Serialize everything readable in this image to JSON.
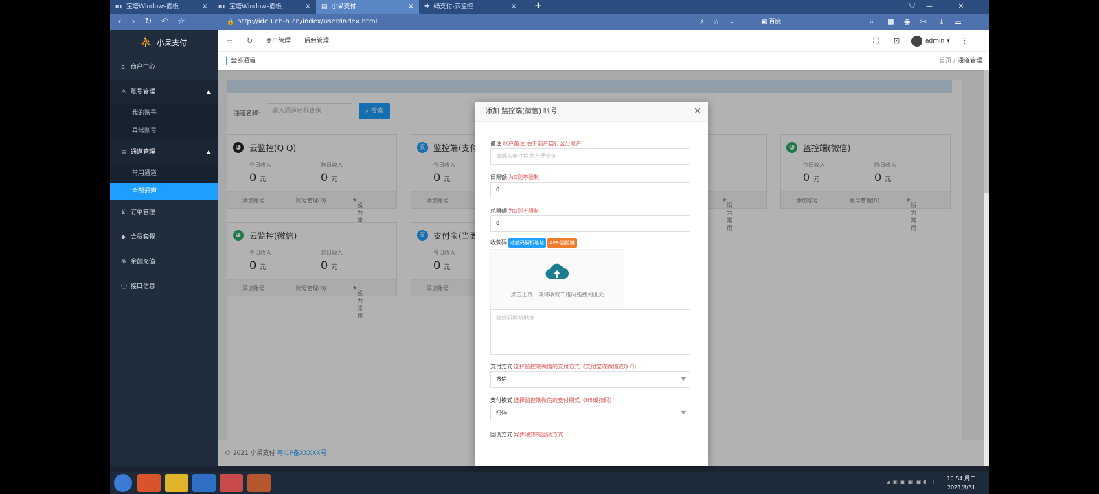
{
  "browser": {
    "tabs": [
      {
        "prefix": "BT",
        "label": "宝塔Windows面板",
        "active": false
      },
      {
        "prefix": "BT",
        "label": "宝塔Windows面板",
        "active": false
      },
      {
        "prefix": "",
        "label": "小呆支付",
        "active": true
      },
      {
        "prefix": "",
        "label": "码支付-云监控",
        "active": false
      }
    ],
    "url": "http://idc3.ch-h.cn/index/user/index.html",
    "search_engine": "百度"
  },
  "sidebar": {
    "brand": "小呆支付",
    "items": [
      {
        "label": "商户中心",
        "icon": "home-icon"
      },
      {
        "label": "账号管理",
        "icon": "user-icon",
        "open": true,
        "children": [
          "我的账号",
          "异常账号"
        ]
      },
      {
        "label": "通道管理",
        "icon": "channel-icon",
        "open": true,
        "children": [
          "常用通道",
          "全部通道"
        ]
      },
      {
        "label": "订单管理",
        "icon": "cart-icon"
      },
      {
        "label": "会员套餐",
        "icon": "diamond-icon"
      },
      {
        "label": "余额充值",
        "icon": "recharge-icon"
      },
      {
        "label": "接口信息",
        "icon": "info-icon"
      }
    ],
    "active_sub": "全部通道"
  },
  "header": {
    "links": [
      "商户管理",
      "后台管理"
    ],
    "user": "admin"
  },
  "breadcrumb": {
    "left": "全部通道",
    "home": "首页",
    "sep": "/",
    "current": "通道管理"
  },
  "search": {
    "label": "通道名称:",
    "placeholder": "输入通道名称查询",
    "button": "搜索"
  },
  "cards_common": {
    "today_label": "今日收入",
    "yesterday_label": "昨日收入",
    "unit": "元",
    "add": "添加账号",
    "manage": "账号管理(0)",
    "set_common": "设为常用"
  },
  "cards": [
    {
      "title": "云监控(Q Q)",
      "today": "0",
      "yesterday": "0",
      "icon": "qq-icon",
      "color": "#222222"
    },
    {
      "title": "监控端(支付",
      "today": "0",
      "yesterday": "",
      "icon": "alipay-icon",
      "color": "#1e9fff"
    },
    {
      "title": "监控端(微信)",
      "today": "0",
      "yesterday": "0",
      "icon": "wechat-icon",
      "color": "#2aae67"
    },
    {
      "title": "云监控(微信)",
      "today": "0",
      "yesterday": "0",
      "icon": "wechat-icon",
      "color": "#2aae67"
    },
    {
      "title": "支付宝(当面",
      "today": "0",
      "yesterday": "",
      "icon": "alipay-icon",
      "color": "#1e9fff"
    }
  ],
  "modal": {
    "title": "添加 监控端(微信) 帐号",
    "remark_label": "备注",
    "remark_hint": "账户备注,便于商户自行区分账户",
    "remark_placeholder": "请输入备注信息方便查询",
    "daily_label": "日限额",
    "daily_hint": "为0则不限制",
    "daily_value": "0",
    "total_label": "总限额",
    "total_hint": "为0则不限制",
    "total_value": "0",
    "qrcode_label": "收款码",
    "tag1": "收款码解析地址",
    "tag2": "APP-监控端",
    "upload_text": "点击上传，或将收款二维码拖拽到此处",
    "textarea_placeholder": "收款码解析地址",
    "pay_method_label": "支付方式",
    "pay_method_hint": "选择监控端微信的支付方式（支付宝或微信或Q Q）",
    "pay_method_value": "微信",
    "pay_mode_label": "支付模式",
    "pay_mode_hint": "选择监控端微信的支付模式（H5或扫码）",
    "pay_mode_value": "扫码",
    "callback_label": "回调方式",
    "callback_hint": "异步通知的回调方式"
  },
  "footer": {
    "copyright": "© 2021 小呆支付",
    "icp": "粤ICP备XXXXX号"
  },
  "taskbar": {
    "time": "10:54 周二",
    "date": "2021/8/31"
  },
  "colors": {
    "accent": "#1e9fff",
    "sidebar": "#1f2d3d",
    "hint_red": "#d9534f"
  }
}
